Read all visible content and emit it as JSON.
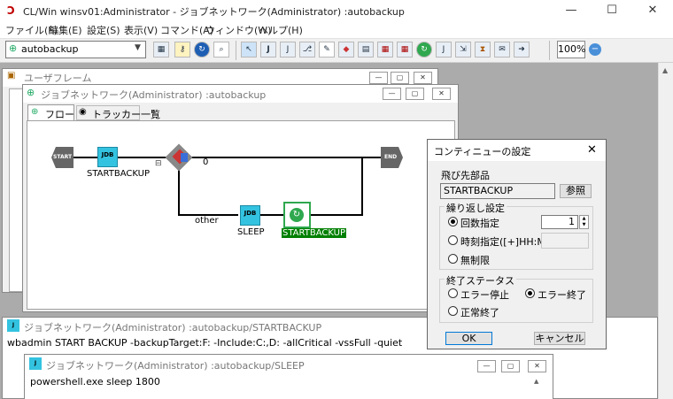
{
  "app": {
    "title": "CL/Win winsv01:Administrator - ジョブネットワーク(Administrator) :autobackup",
    "minimize": "—",
    "maximize": "☐",
    "close": "✕"
  },
  "menu": [
    "ファイル(F)",
    "編集(E)",
    "設定(S)",
    "表示(V)",
    "コマンド(A)",
    "ウィンドウ(W)",
    "ヘルプ(H)"
  ],
  "toolbar": {
    "combo_value": "autobackup",
    "zoom": "100%",
    "icons": [
      "folder-open-icon",
      "key-icon",
      "refresh-icon",
      "search-icon",
      "pointer-icon",
      "jdb-icon",
      "jnw-icon",
      "branch-icon",
      "comment-icon",
      "diamond-icon",
      "calendar-icon",
      "calendar-check-icon",
      "calendar-x-icon",
      "continue-icon",
      "jdb-x-icon",
      "send-icon",
      "hourglass-icon",
      "mail-icon",
      "arrow-icon"
    ]
  },
  "user_frame": {
    "title": "ユーザフレーム"
  },
  "jobnet_window": {
    "title": "ジョブネットワーク(Administrator) :autobackup",
    "tabs": [
      "フロー",
      "トラッカー一覧"
    ],
    "flow": {
      "start": "START",
      "end": "END",
      "job1": "STARTBACKUP",
      "job2": "SLEEP",
      "continue": "STARTBACKUP",
      "branch_zero": "0",
      "branch_other": "other",
      "collapse": "⊟",
      "jdb": "JDB"
    }
  },
  "job_window_1": {
    "title": "ジョブネットワーク(Administrator) :autobackup/STARTBACKUP",
    "content": "wbadmin START BACKUP -backupTarget:F: -Include:C:,D: -allCritical -vssFull -quiet"
  },
  "job_window_2": {
    "title": "ジョブネットワーク(Administrator) :autobackup/SLEEP",
    "content": "powershell.exe sleep 1800"
  },
  "dialog": {
    "title": "コンティニューの設定",
    "target_label": "飛び先部品",
    "target_value": "STARTBACKUP",
    "browse": "参照",
    "repeat_group": "繰り返し設定",
    "count_label": "回数指定",
    "count_value": "1",
    "time_label": "時刻指定([+]HH:MM)",
    "unlimited_label": "無制限",
    "exit_group": "終了ステータス",
    "error_stop": "エラー停止",
    "error_end": "エラー終了",
    "normal_end": "正常終了",
    "ok": "OK",
    "cancel": "キャンセル"
  },
  "colors": {
    "accent": "#0078d7",
    "job_icon": "#33c3e0",
    "continue_icon": "#2fa84f",
    "selection": "#008000"
  }
}
